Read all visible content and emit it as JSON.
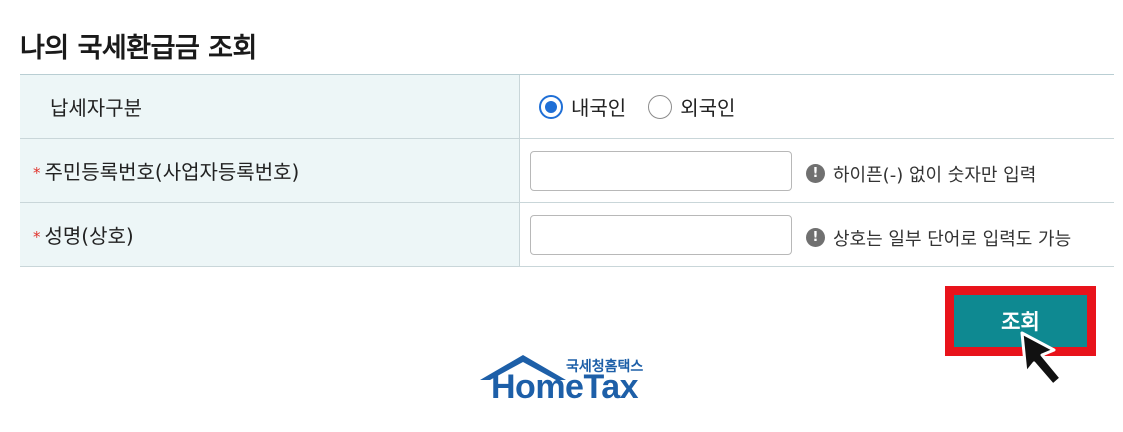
{
  "title": "나의 국세환급금 조회",
  "colors": {
    "accent": "#0e8991",
    "highlight": "#e8131b",
    "radio": "#1f6fd6",
    "label_bg": "#edf6f7",
    "logo": "#1d5fa8"
  },
  "form": {
    "taxpayer_type": {
      "label": "납세자구분",
      "options": [
        {
          "label": "내국인",
          "checked": true
        },
        {
          "label": "외국인",
          "checked": false
        }
      ]
    },
    "resident_number": {
      "required_mark": "*",
      "label": "주민등록번호(사업자등록번호)",
      "value": "",
      "hint_icon": "!",
      "hint": "하이픈(-) 없이 숫자만 입력"
    },
    "name": {
      "required_mark": "*",
      "label": "성명(상호)",
      "value": "",
      "hint_icon": "!",
      "hint": "상호는 일부 단어로 입력도 가능"
    }
  },
  "search_button": {
    "label": "조회"
  },
  "logo": {
    "small_text": "국세청홈택스",
    "big_text": "HomeTax"
  }
}
